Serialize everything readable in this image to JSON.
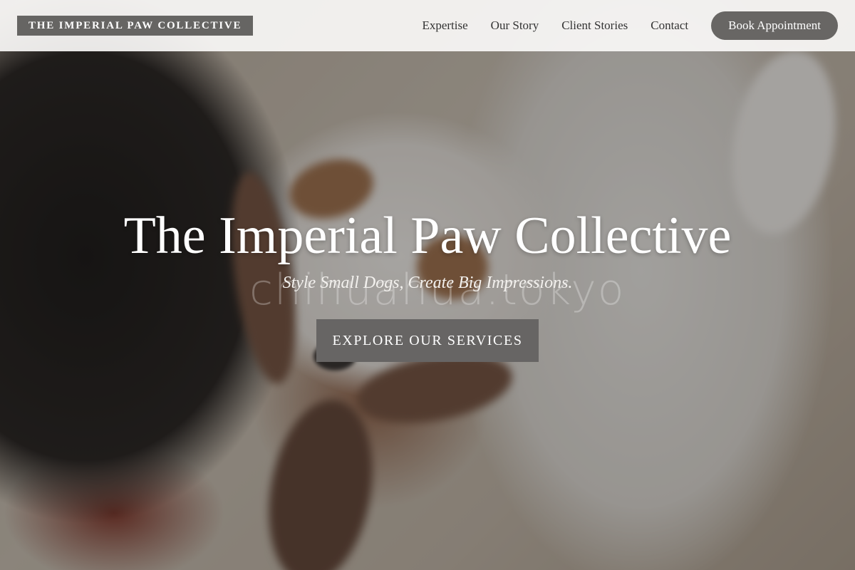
{
  "brand": {
    "logo_text": "THE IMPERIAL PAW COLLECTIVE"
  },
  "nav": {
    "items": [
      {
        "label": "Expertise"
      },
      {
        "label": "Our Story"
      },
      {
        "label": "Client Stories"
      },
      {
        "label": "Contact"
      }
    ],
    "cta_label": "Book Appointment"
  },
  "hero": {
    "title": "The Imperial Paw Collective",
    "tagline": "Style Small Dogs, Create Big Impressions.",
    "cta_label": "EXPLORE OUR SERVICES",
    "image_watermark": "chihuahua.tokyo"
  },
  "colors": {
    "header_bg": "#faf9f7",
    "logo_bg": "#666563",
    "button_bg": "#686664",
    "hero_text": "#ffffff"
  }
}
